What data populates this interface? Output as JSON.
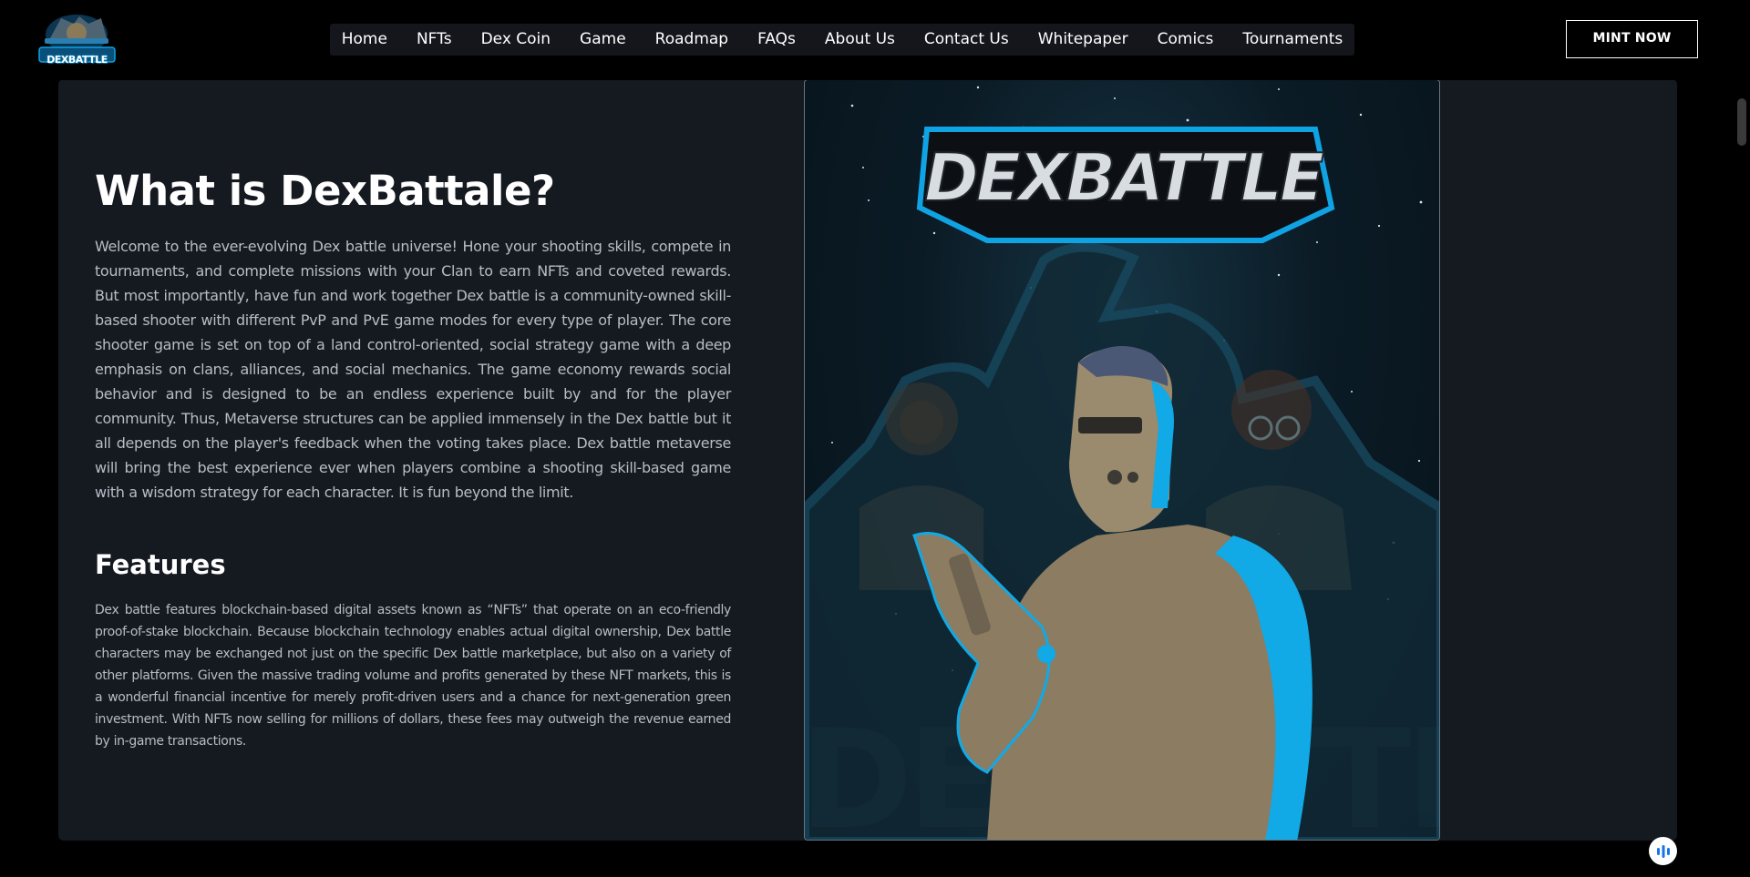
{
  "header": {
    "logo_text": "DEXBATTLE",
    "nav": [
      {
        "label": "Home"
      },
      {
        "label": "NFTs"
      },
      {
        "label": "Dex Coin"
      },
      {
        "label": "Game"
      },
      {
        "label": "Roadmap"
      },
      {
        "label": "FAQs"
      },
      {
        "label": "About Us"
      },
      {
        "label": "Contact Us"
      },
      {
        "label": "Whitepaper"
      },
      {
        "label": "Comics"
      },
      {
        "label": "Tournaments"
      }
    ],
    "mint_label": "MINT NOW"
  },
  "main": {
    "title": "What is DexBattale?",
    "intro": "Welcome to the ever-evolving Dex battle universe! Hone your shooting skills, compete in tournaments, and complete missions with your Clan to earn NFTs and coveted rewards. But most importantly, have fun and work together Dex battle is a community-owned skill-based shooter with different PvP and PvE game modes for every type of player. The core shooter game is set on top of a land control-oriented, social strategy game with a deep emphasis on clans, alliances, and social mechanics. The game economy rewards social behavior and is designed to be an endless experience built by and for the player community. Thus, Metaverse structures can be applied immensely in the Dex battle but it all depends on the player's feedback when the voting takes place. Dex battle metaverse will bring the best experience ever when players combine a shooting skill-based game with a wisdom strategy for each character. It is fun beyond the limit.",
    "features_title": "Features",
    "features_text": "Dex battle features blockchain-based digital assets known as “NFTs” that operate on an eco-friendly proof-of-stake blockchain. Because blockchain technology enables actual digital ownership, Dex battle characters may be exchanged not just on the specific Dex battle marketplace, but also on a variety of other platforms. Given the massive trading volume and profits generated by these NFT markets, this is a wonderful financial incentive for merely profit-driven users and a chance for next-generation green investment. With NFTs now selling for millions of dollars, these fees may outweigh the revenue earned by in-game transactions.",
    "art_logo_text": "DEXBATTLE"
  },
  "colors": {
    "accent": "#0aa3e6",
    "panel": "#151920",
    "body_text": "#b7bdc6"
  },
  "icons": {
    "fab": "audio-wave-icon"
  }
}
